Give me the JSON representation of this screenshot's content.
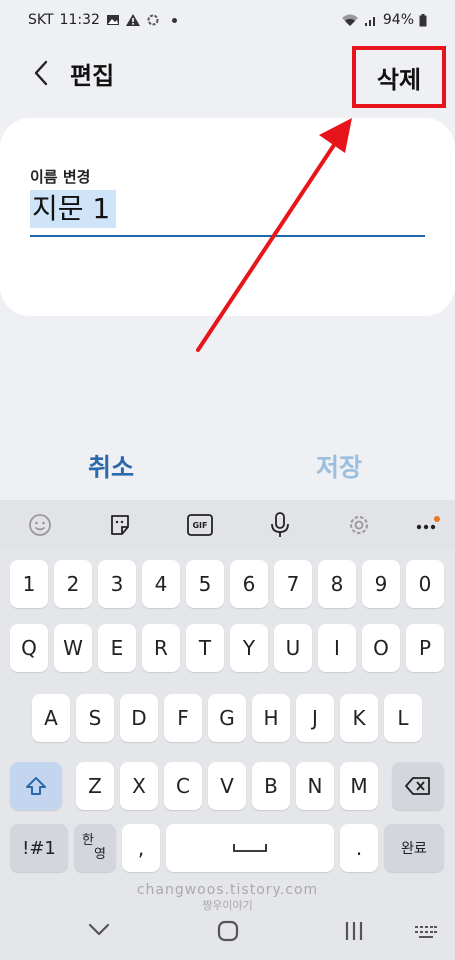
{
  "status_bar": {
    "carrier": "SKT",
    "time": "11:32",
    "battery": "94%"
  },
  "header": {
    "title": "편집",
    "delete_label": "삭제"
  },
  "card": {
    "field_label": "이름 변경",
    "field_value": "지문 1"
  },
  "actions": {
    "cancel_label": "취소",
    "save_label": "저장"
  },
  "keyboard": {
    "toolbar_icons": [
      "emoji-icon",
      "sticker-icon",
      "gif-icon",
      "microphone-icon",
      "settings-icon",
      "more-icon"
    ],
    "gif_label": "GIF",
    "row_numbers": [
      "1",
      "2",
      "3",
      "4",
      "5",
      "6",
      "7",
      "8",
      "9",
      "0"
    ],
    "row_q": [
      "Q",
      "W",
      "E",
      "R",
      "T",
      "Y",
      "U",
      "I",
      "O",
      "P"
    ],
    "row_a": [
      "A",
      "S",
      "D",
      "F",
      "G",
      "H",
      "J",
      "K",
      "L"
    ],
    "row_z": [
      "Z",
      "X",
      "C",
      "V",
      "B",
      "N",
      "M"
    ],
    "symbols_label": "!#1",
    "lang_top": "한",
    "lang_bottom": "영",
    "comma": ",",
    "period": ".",
    "done_label": "완료"
  },
  "watermark": {
    "line1": "changwoos.tistory.com",
    "line2": "짱우이야기"
  },
  "colors": {
    "accent": "#2b6aaa",
    "annotation_red": "#e8141b",
    "selection": "#cfe4f8"
  }
}
